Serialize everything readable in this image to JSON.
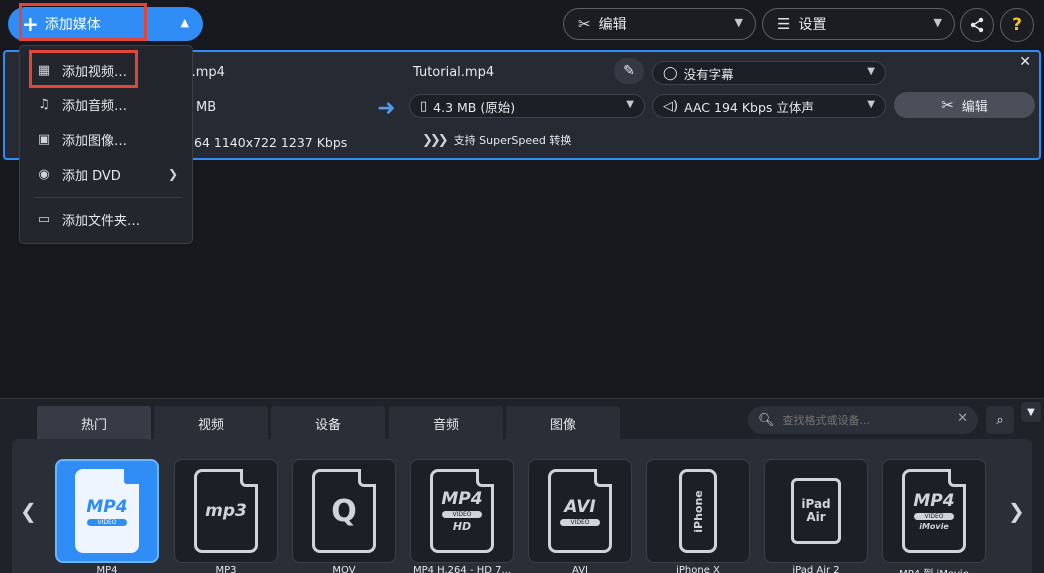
{
  "toolbar": {
    "add_media_label": "添加媒体",
    "edit_label": "编辑",
    "settings_label": "设置",
    "help_label": "?"
  },
  "dropdown": {
    "items": [
      {
        "label": "添加视频…",
        "icon": "film-icon"
      },
      {
        "label": "添加音频…",
        "icon": "music-note-icon"
      },
      {
        "label": "添加图像…",
        "icon": "image-icon"
      },
      {
        "label": "添加 DVD",
        "icon": "disc-icon"
      },
      {
        "label": "添加文件夹…",
        "icon": "folder-icon"
      }
    ]
  },
  "file": {
    "source_name_partial": "l.mp4",
    "source_size_partial": "MB",
    "source_info_partial": "64 1140x722 1237 Kbps",
    "output_name": "Tutorial.mp4",
    "output_size": "4.3 MB (原始)",
    "subtitle": "没有字幕",
    "audio": "AAC 194 Kbps 立体声",
    "edit_label": "编辑",
    "superspeed": "支持 SuperSpeed 转换"
  },
  "formats_panel": {
    "tabs": [
      "热门",
      "视频",
      "设备",
      "音频",
      "图像"
    ],
    "active_tab": 0,
    "search_placeholder": "查找格式或设备...",
    "items": [
      {
        "label": "MP4",
        "icon_text": "MP4",
        "band": "VIDEO"
      },
      {
        "label": "MP3",
        "icon_text": "mp3"
      },
      {
        "label": "MOV",
        "icon_text": "Q"
      },
      {
        "label": "MP4 H.264 - HD 7...",
        "icon_text": "MP4",
        "band": "VIDEO",
        "extra": "HD"
      },
      {
        "label": "AVI",
        "icon_text": "AVI",
        "band": "VIDEO"
      },
      {
        "label": "iPhone X",
        "icon_text": "iPhone"
      },
      {
        "label": "iPad Air 2",
        "icon_text": "iPad Air"
      },
      {
        "label": "MP4 到 iMovie",
        "icon_text": "MP4",
        "band": "VIDEO",
        "extra": "iMovie"
      }
    ]
  },
  "colors": {
    "accent": "#2f8df5",
    "highlight": "#e2463b",
    "background": "#16181d",
    "help": "#f5c21b"
  }
}
